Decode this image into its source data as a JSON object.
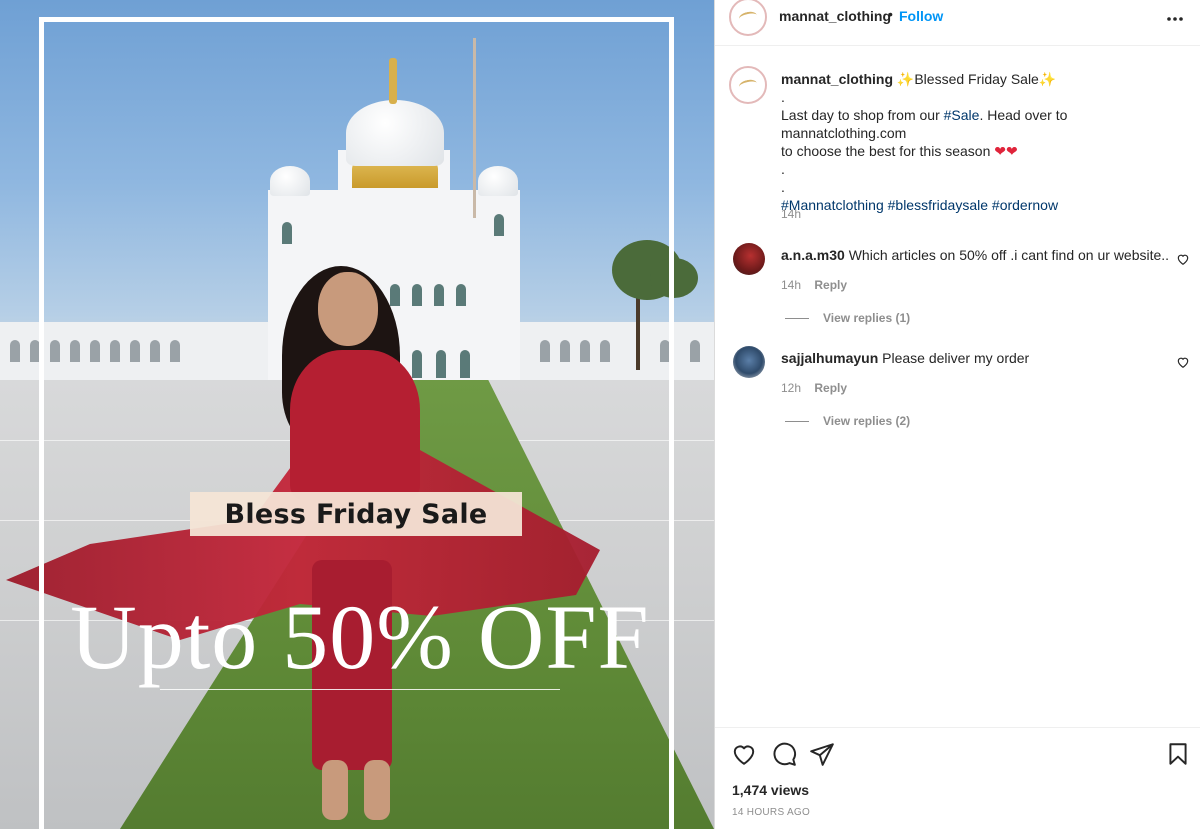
{
  "media": {
    "banner_text": "Bless Friday Sale",
    "offer_text": "Upto 50% OFF"
  },
  "header": {
    "username": "mannat_clothing",
    "separator": "•",
    "follow_label": "Follow",
    "more_icon": "more-options-icon"
  },
  "caption": {
    "username": "mannat_clothing",
    "title": "Blessed Friday Sale",
    "sparkle": "✨",
    "dot": ".",
    "line1_pre": "Last day to shop from our ",
    "line1_tag": "#Sale",
    "line1_post": ". Head over to mannatclothing.com",
    "line2": "to choose the best for this season",
    "hearts": "❤❤",
    "hashtags": "#Mannatclothing #blessfridaysale #ordernow",
    "time": "14h"
  },
  "comments": [
    {
      "username": "a.n.a.m30",
      "text": "Which articles on 50% off .i cant find on ur website..",
      "time": "14h",
      "reply_label": "Reply",
      "view_replies": "View replies (1)"
    },
    {
      "username": "sajjalhumayun",
      "text": "Please deliver my order",
      "time": "12h",
      "reply_label": "Reply",
      "view_replies": "View replies (2)"
    }
  ],
  "footer": {
    "views": "1,474 views",
    "posted_ago": "14 HOURS AGO",
    "icons": [
      "like-icon",
      "comment-icon",
      "share-icon",
      "save-icon"
    ]
  },
  "colors": {
    "link_blue": "#0095f6",
    "hashtag_blue": "#00376b",
    "secondary_text": "#8e8e8e",
    "heart_red": "#e0243b"
  }
}
